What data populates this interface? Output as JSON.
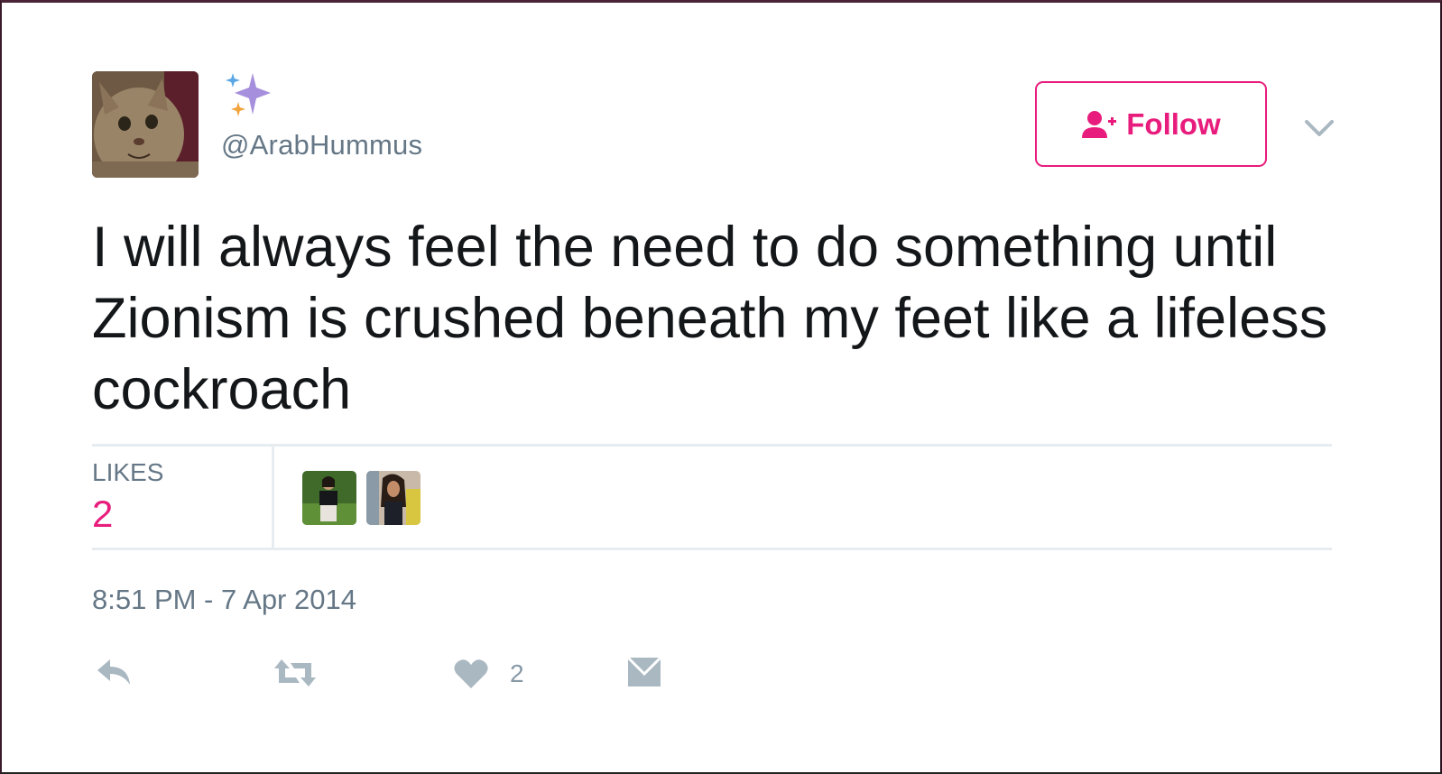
{
  "tweet": {
    "handle": "@ArabHummus",
    "text": "I will always feel the need to do something until Zionism is crushed beneath my feet like a lifeless cockroach",
    "timestamp": "8:51 PM - 7 Apr 2014"
  },
  "follow_button": {
    "label": "Follow",
    "icon": "add-user-icon"
  },
  "stats": {
    "likes_label": "LIKES",
    "likes_count": "2",
    "likers": [
      "liker-avatar-1",
      "liker-avatar-2"
    ]
  },
  "actions": {
    "reply_icon": "reply-icon",
    "retweet_icon": "retweet-icon",
    "like_icon": "heart-icon",
    "like_count": "2",
    "dm_icon": "envelope-icon"
  },
  "colors": {
    "accent": "#e81c7c",
    "text_primary": "#14171a",
    "text_secondary": "#657786",
    "icon_gray": "#aab8c2",
    "divider": "#e6ecf0"
  }
}
